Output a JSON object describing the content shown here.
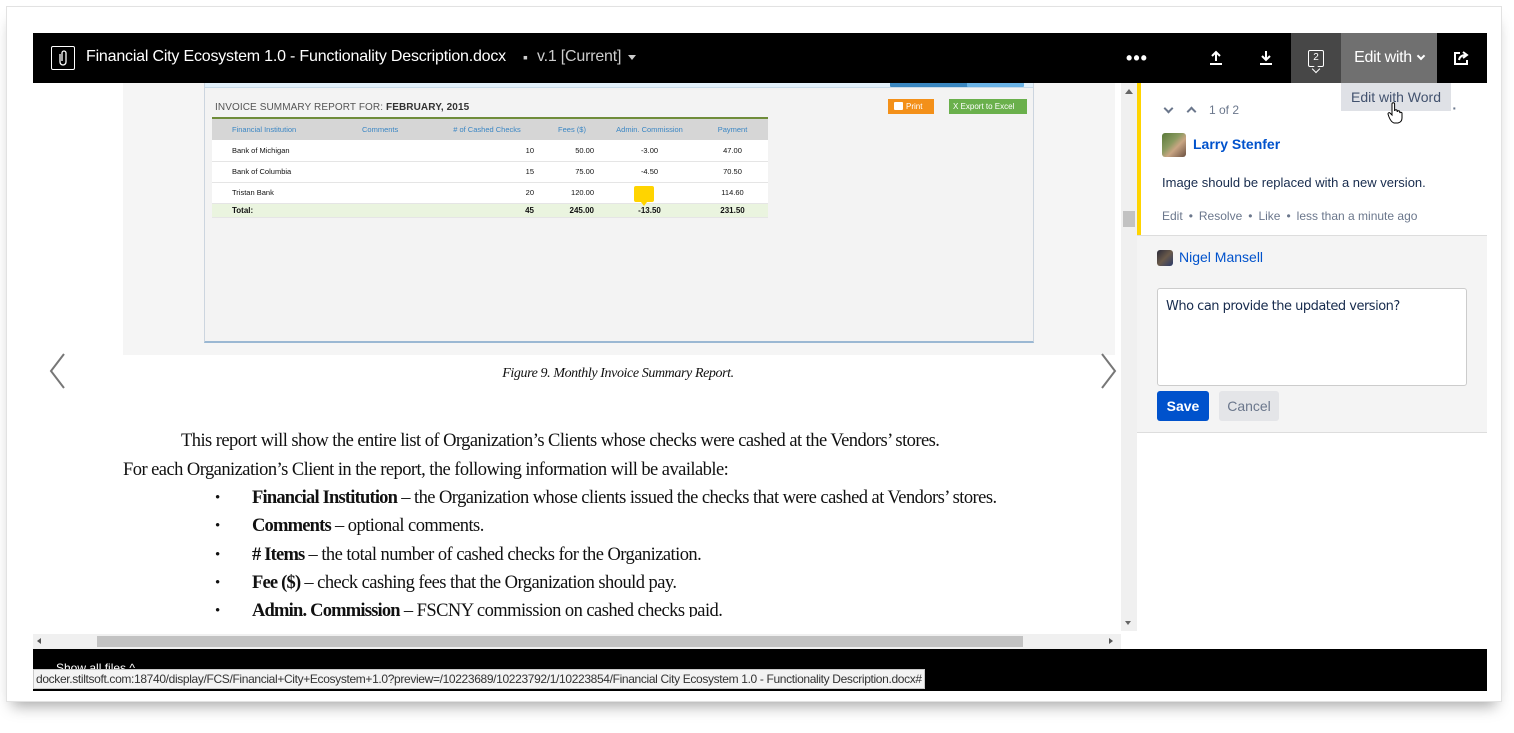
{
  "header": {
    "document_title": "Financial City Ecosystem 1.0 - Functionality Description.docx",
    "version_label": "v.1 [Current]",
    "comment_count": "2",
    "edit_with_label": "Edit with",
    "more_label": "•••",
    "icons": [
      "paperclip-icon",
      "more-icon",
      "upload-icon",
      "download-icon",
      "comments-icon",
      "chevron-down-icon",
      "share-icon"
    ]
  },
  "edit_menu": {
    "items": [
      "Edit with Word"
    ]
  },
  "document": {
    "figure": {
      "report_title_prefix": "INVOICE SUMMARY REPORT FOR: ",
      "report_title_period": "FEBRUARY, 2015",
      "print_label": "Print",
      "export_label": "X  Export to Excel",
      "columns": [
        "Financial Institution",
        "Comments",
        "# of Cashed Checks",
        "Fees ($)",
        "Admin. Commission",
        "Payment"
      ],
      "rows": [
        {
          "institution": "Bank of Michigan",
          "comments": "",
          "checks": "10",
          "fees": "50.00",
          "commission": "-3.00",
          "payment": "47.00"
        },
        {
          "institution": "Bank of Columbia",
          "comments": "",
          "checks": "15",
          "fees": "75.00",
          "commission": "-4.50",
          "payment": "70.50"
        },
        {
          "institution": "Tristan Bank",
          "comments": "",
          "checks": "20",
          "fees": "120.00",
          "commission": "",
          "payment": "114.60"
        }
      ],
      "total": {
        "label": "Total:",
        "checks": "45",
        "fees": "245.00",
        "commission": "-13.50",
        "payment": "231.50"
      }
    },
    "caption": "Figure 9. Monthly Invoice Summary Report.",
    "paragraph_line1": "This report will show the entire list of Organization’s Clients whose checks were cashed at the Vendors’ stores.",
    "paragraph_line2": "For each Organization’s Client in the report, the following information will be available:",
    "bullets": [
      {
        "term": "Financial Institution",
        "text": " – the Organization whose clients issued the checks that were cashed at Vendors’ stores."
      },
      {
        "term": "Comments",
        "text": " – optional comments."
      },
      {
        "term": "# Items",
        "text": " – the total number of cashed checks for the Organization."
      },
      {
        "term": "Fee ($)",
        "text": " – check cashing fees that the Organization should pay."
      },
      {
        "term": "Admin. Commission",
        "text": " – FSCNY commission on cashed checks paid."
      }
    ]
  },
  "comments": {
    "position": "1 of 2",
    "thread": {
      "author": "Larry Stenfer",
      "body": "Image should be replaced with a new version.",
      "actions": [
        "Edit",
        "Resolve",
        "Like"
      ],
      "timestamp": "less than a minute ago"
    },
    "reply": {
      "author": "Nigel Mansell",
      "value": "Who can provide the updated version?",
      "save_label": "Save",
      "cancel_label": "Cancel"
    }
  },
  "footer": {
    "show_all_files": "Show all files ^",
    "status_url": "docker.stiltsoft.com:18740/display/FCS/Financial+City+Ecosystem+1.0?preview=/10223689/10223792/1/10223854/Financial City Ecosystem 1.0 - Functionality Description.docx#"
  }
}
